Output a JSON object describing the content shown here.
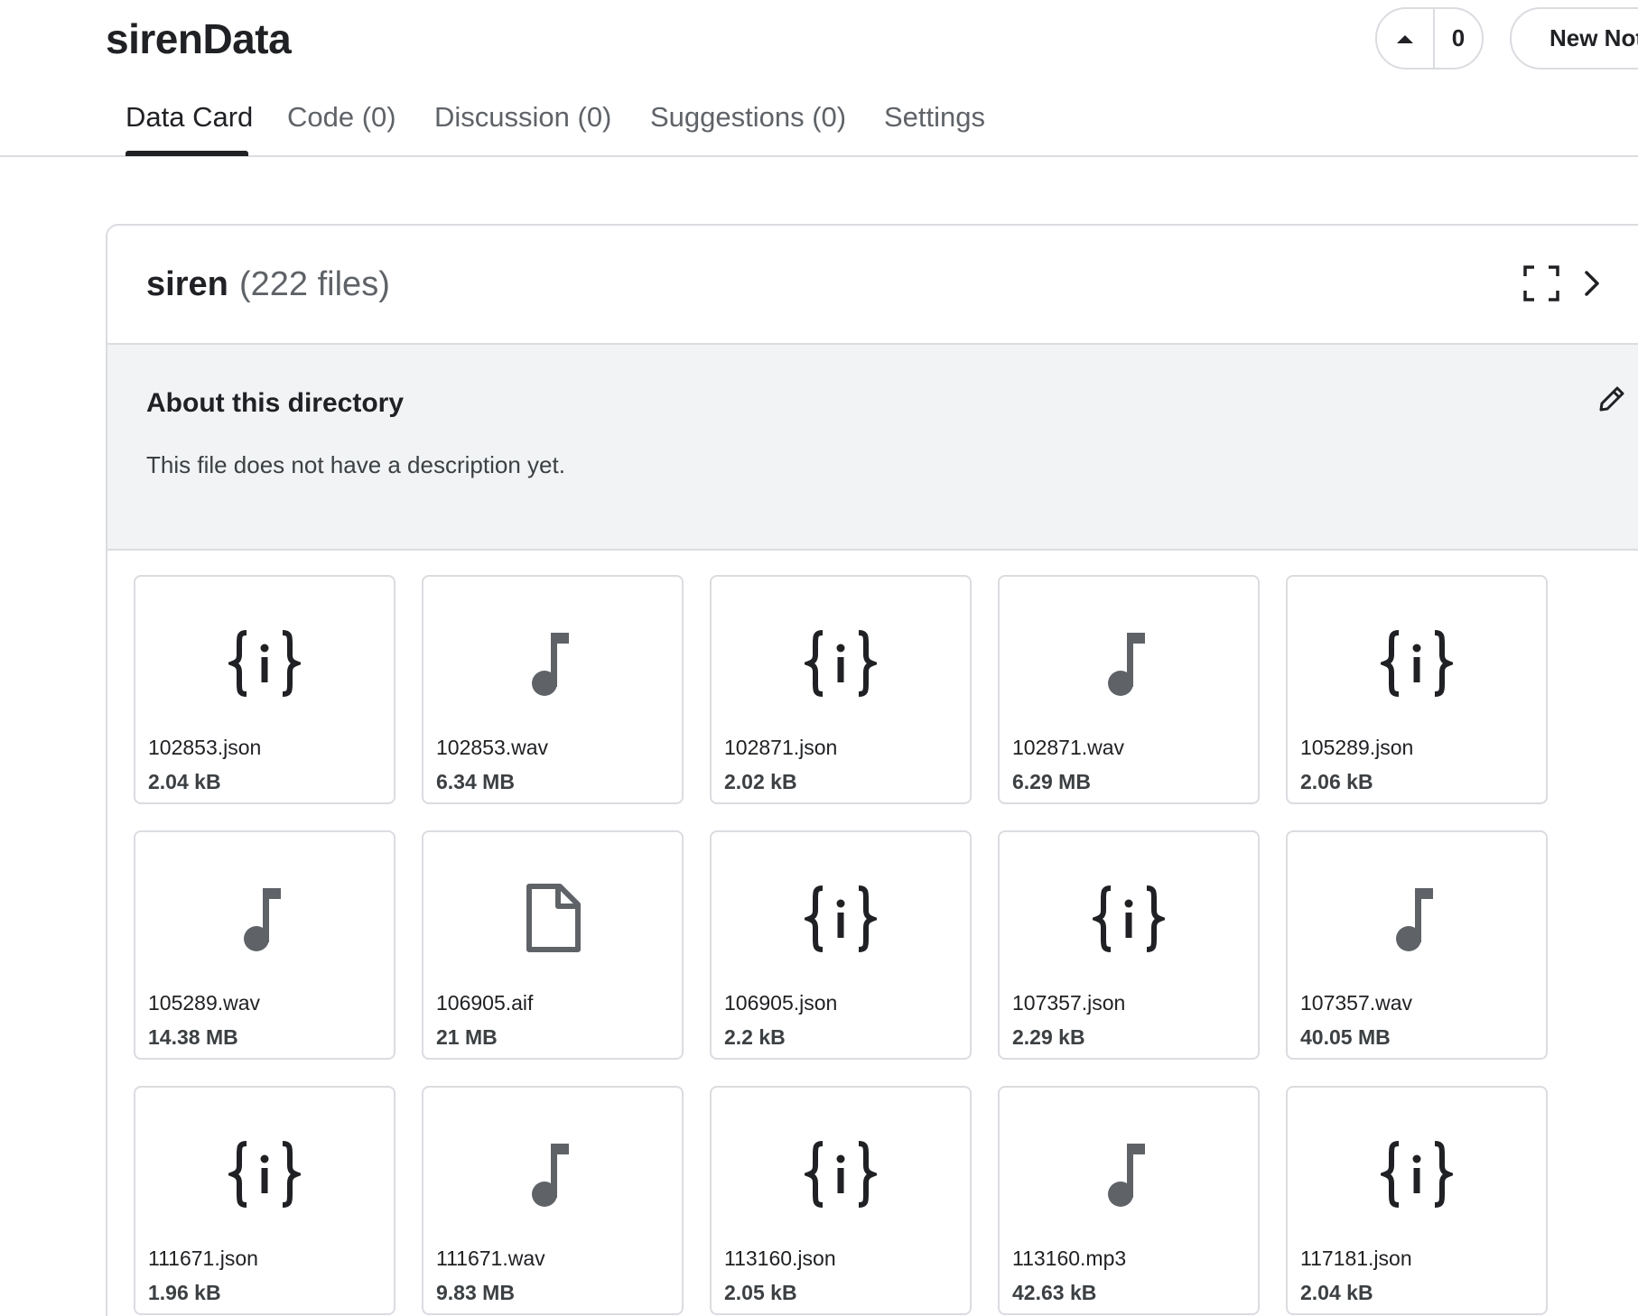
{
  "header": {
    "title": "sirenData",
    "vote_count": "0",
    "new_notebook_label": "New Notebook"
  },
  "tabs": [
    {
      "label": "Data Card",
      "active": true
    },
    {
      "label": "Code (0)"
    },
    {
      "label": "Discussion (0)"
    },
    {
      "label": "Suggestions (0)"
    },
    {
      "label": "Settings"
    }
  ],
  "directory": {
    "name": "siren",
    "file_count": "(222 files)",
    "about_title": "About this directory",
    "description": "This file does not have a description yet.",
    "files": [
      {
        "name": "102853.json",
        "size": "2.04 kB",
        "icon": "json-icon"
      },
      {
        "name": "102853.wav",
        "size": "6.34 MB",
        "icon": "music-note-icon"
      },
      {
        "name": "102871.json",
        "size": "2.02 kB",
        "icon": "json-icon"
      },
      {
        "name": "102871.wav",
        "size": "6.29 MB",
        "icon": "music-note-icon"
      },
      {
        "name": "105289.json",
        "size": "2.06 kB",
        "icon": "json-icon"
      },
      {
        "name": "105289.wav",
        "size": "14.38 MB",
        "icon": "music-note-icon"
      },
      {
        "name": "106905.aif",
        "size": "21 MB",
        "icon": "file-icon"
      },
      {
        "name": "106905.json",
        "size": "2.2 kB",
        "icon": "json-icon"
      },
      {
        "name": "107357.json",
        "size": "2.29 kB",
        "icon": "json-icon"
      },
      {
        "name": "107357.wav",
        "size": "40.05 MB",
        "icon": "music-note-icon"
      },
      {
        "name": "111671.json",
        "size": "1.96 kB",
        "icon": "json-icon"
      },
      {
        "name": "111671.wav",
        "size": "9.83 MB",
        "icon": "music-note-icon"
      },
      {
        "name": "113160.json",
        "size": "2.05 kB",
        "icon": "json-icon"
      },
      {
        "name": "113160.mp3",
        "size": "42.63 kB",
        "icon": "music-note-icon"
      },
      {
        "name": "117181.json",
        "size": "2.04 kB",
        "icon": "json-icon"
      }
    ]
  },
  "colors": {
    "text_primary": "#202124",
    "text_secondary": "#5f6368",
    "border": "#dadce0",
    "about_bg": "#f1f3f4",
    "icon_gray": "#5f6368"
  }
}
